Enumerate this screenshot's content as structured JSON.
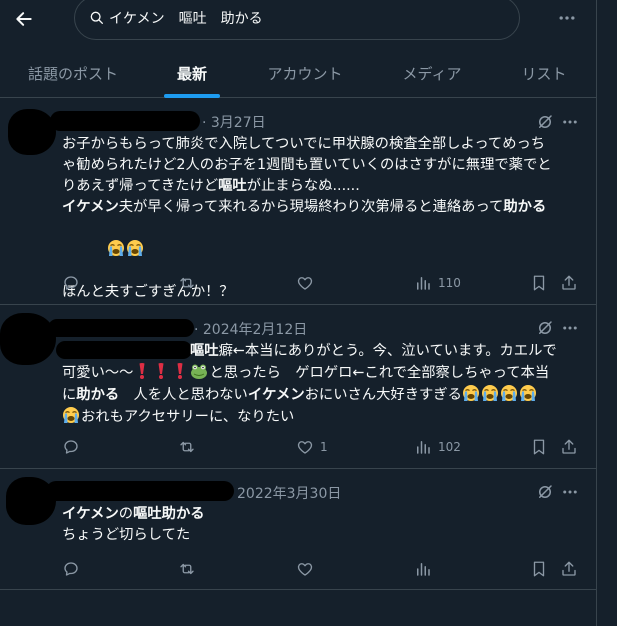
{
  "search": {
    "query": "イケメン　嘔吐　助かる"
  },
  "tabs": [
    {
      "label": "話題のポスト"
    },
    {
      "label": "最新"
    },
    {
      "label": "アカウント"
    },
    {
      "label": "メディア"
    },
    {
      "label": "リスト"
    }
  ],
  "active_tab": "最新",
  "tweets": [
    {
      "date": "· 3月27日",
      "lines": {
        "l1": "お子からもらって肺炎で入院してついでに甲状腺の検査全部しよってめっち",
        "l2": "ゃ勧められたけど2人のお子を1週間も置いていくのはさすがに無理で薬でと",
        "l3a": "りあえず帰ってきたけど",
        "l3b": "嘔吐",
        "l3c": "が止まらなぬ......",
        "l4a": "イケメン",
        "l4b": "夫が早く帰って来れるから現場終わり次第帰ると連絡あって",
        "l4c": "助かる",
        "l6": "ほんと夫すごすぎんか！？"
      },
      "views": "110",
      "likes": ""
    },
    {
      "date": "· 2024年2月12日",
      "lines": {
        "l1a": "嘔吐",
        "l1b": "癖←本当にありがとう。今、泣いています。カエルで",
        "l2a": "可愛い〜〜",
        "l2b": "と思ったら　ゲロゲロ←これで全部察しちゃって本当",
        "l3a": "に",
        "l3b": "助かる",
        "l3c": "　人を人と思わない",
        "l3d": "イケメン",
        "l3e": "おにいさん大好きすぎる",
        "l4": "おれもアクセサリーに、なりたい"
      },
      "views": "102",
      "likes": "1"
    },
    {
      "date": "2022年3月30日",
      "lines": {
        "l1a": "イケメン",
        "l1b": "の",
        "l1c": "嘔吐助かる",
        "l2": "ちょうど切らしてた"
      },
      "views": "",
      "likes": ""
    }
  ],
  "icons": {
    "back": "arrow-left-icon",
    "search": "search-icon",
    "more": "more-icon",
    "grok": "grok-icon",
    "reply": "reply-icon",
    "retweet": "retweet-icon",
    "like": "heart-icon",
    "views": "views-icon",
    "bookmark": "bookmark-icon",
    "share": "share-icon",
    "emoji_crying": "loudly-crying-face-icon",
    "emoji_exclamation": "red-exclamation-icon",
    "emoji_frog": "frog-icon"
  },
  "colors": {
    "background": "#15202b",
    "accent": "#1d9bf0",
    "muted": "#8b98a5",
    "text": "#f7f9f9",
    "border": "#38444d"
  }
}
